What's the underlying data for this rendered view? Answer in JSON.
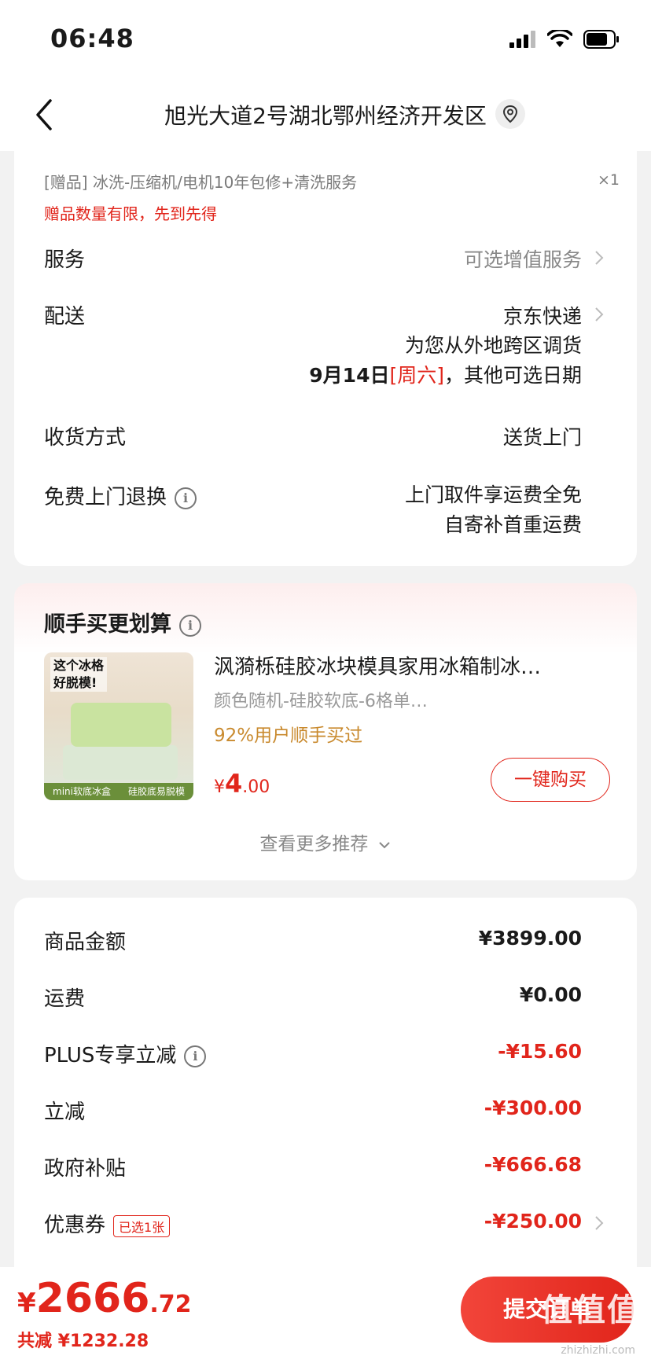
{
  "status_bar": {
    "time": "06:48"
  },
  "nav": {
    "address": "旭光大道2号湖北鄂州经济开发区",
    "back_icon": "chevron-left-icon",
    "location_icon": "location-pin-icon"
  },
  "gift": {
    "text": "[赠品] 冰洗-压缩机/电机10年包修+清洗服务",
    "qty": "×1",
    "warning": "赠品数量有限，先到先得"
  },
  "service": {
    "label": "服务",
    "value": "可选增值服务"
  },
  "delivery": {
    "label": "配送",
    "carrier": "京东快递",
    "note": "为您从外地跨区调货",
    "date": "9月14日",
    "weekday": "[周六]",
    "date_suffix": "，其他可选日期"
  },
  "receive": {
    "label": "收货方式",
    "value": "送货上门"
  },
  "free_return": {
    "label": "免费上门退换",
    "line1": "上门取件享运费全免",
    "line2": "自寄补首重运费"
  },
  "addon": {
    "title": "顺手买更划算",
    "product_title": "沨漪栎硅胶冰块模具家用冰箱制冰…",
    "spec": "颜色随机-硅胶软底-6格单…",
    "stat": "92%用户顺手买过",
    "price_symbol": "¥",
    "price_int": "4",
    "price_dec": ".00",
    "buy_label": "一键购买",
    "more_label": "查看更多推荐",
    "image_tag_line1": "这个冰格",
    "image_tag_line2": "好脱模!",
    "image_foot_left": "mini软底冰盒",
    "image_foot_right": "硅胶底易脱模"
  },
  "summary": {
    "goods": {
      "label": "商品金额",
      "value": "¥3899.00"
    },
    "shipping": {
      "label": "运费",
      "value": "¥0.00"
    },
    "plus": {
      "label": "PLUS专享立减",
      "value": "-¥15.60"
    },
    "discount": {
      "label": "立减",
      "value": "-¥300.00"
    },
    "subsidy": {
      "label": "政府补贴",
      "value": "-¥666.68"
    },
    "coupon": {
      "label": "优惠券",
      "badge": "已选1张",
      "value": "-¥250.00"
    }
  },
  "bottom": {
    "total_symbol": "¥",
    "total_int": "2666",
    "total_dec": ".72",
    "saved": "共减 ¥1232.28",
    "submit_label": "提交订单",
    "watermark": "值值值",
    "watermark_url": "zhizhizhi.com"
  },
  "colors": {
    "accent": "#e1251b",
    "highlight": "#c98a2e",
    "muted": "#888888"
  }
}
